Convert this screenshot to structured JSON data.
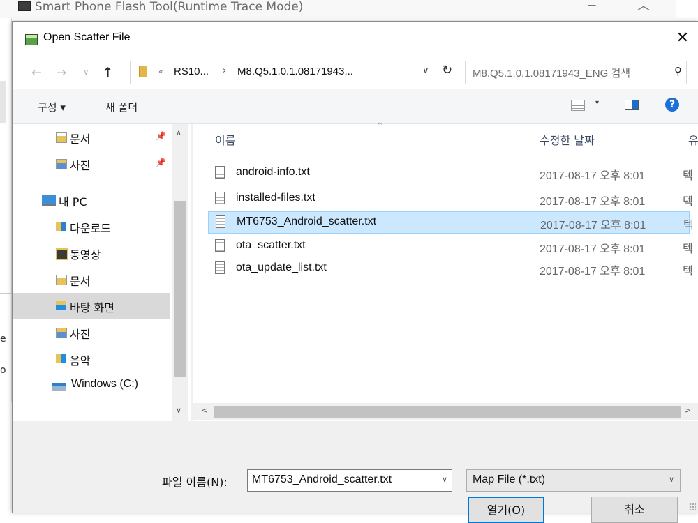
{
  "background_window": {
    "title": "Smart Phone Flash Tool(Runtime Trace Mode)",
    "minimize_glyph": "─",
    "maximize_glyph": "︿",
    "left_glyph_1": "e",
    "left_glyph_2": "o"
  },
  "dialog": {
    "title": "Open Scatter File",
    "close_glyph": "✕"
  },
  "address": {
    "back_glyph": "←",
    "forward_glyph": "→",
    "recent_glyph": "∨",
    "up_glyph": "↑",
    "overflow": "«",
    "crumb1": "RS10...",
    "separator": "›",
    "crumb2": "M8.Q5.1.0.1.08171943...",
    "dropdown_glyph": "∨",
    "refresh_glyph": "↻",
    "search_placeholder": "M8.Q5.1.0.1.08171943_ENG 검색",
    "search_glyph": "⚲"
  },
  "toolbar": {
    "organize": "구성 ▾",
    "new_folder": "새 폴더",
    "view_arrow": "▾",
    "help": "?"
  },
  "nav": {
    "items": [
      {
        "label": "문서",
        "pinned": true,
        "icon": "documents-icon"
      },
      {
        "label": "사진",
        "pinned": true,
        "icon": "pictures-icon"
      },
      {
        "label": "내 PC",
        "icon": "pc-icon"
      },
      {
        "label": "다운로드",
        "icon": "downloads-icon"
      },
      {
        "label": "동영상",
        "icon": "videos-icon"
      },
      {
        "label": "문서",
        "icon": "documents-icon"
      },
      {
        "label": "바탕 화면",
        "icon": "desktop-icon",
        "selected": true
      },
      {
        "label": "사진",
        "icon": "pictures-icon"
      },
      {
        "label": "음악",
        "icon": "music-icon"
      },
      {
        "label": "Windows (C:)",
        "icon": "drive-icon"
      }
    ],
    "pin_glyph": "📌",
    "scroll_up": "∧",
    "scroll_down": "∨"
  },
  "files": {
    "columns": {
      "name": "이름",
      "date": "수정한 날짜",
      "type": "유"
    },
    "sort_glyph": "^",
    "rows": [
      {
        "name": "android-info.txt",
        "date": "2017-08-17 오후 8:01",
        "type": "텍"
      },
      {
        "name": "installed-files.txt",
        "date": "2017-08-17 오후 8:01",
        "type": "텍"
      },
      {
        "name": "MT6753_Android_scatter.txt",
        "date": "2017-08-17 오후 8:01",
        "type": "텍",
        "selected": true
      },
      {
        "name": "ota_scatter.txt",
        "date": "2017-08-17 오후 8:01",
        "type": "텍"
      },
      {
        "name": "ota_update_list.txt",
        "date": "2017-08-17 오후 8:01",
        "type": "텍"
      }
    ],
    "hscroll_left": "<",
    "hscroll_right": ">"
  },
  "bottom": {
    "filename_label": "파일 이름(N):",
    "filename_value": "MT6753_Android_scatter.txt",
    "filter_value": "Map File (*.txt)",
    "dropdown_glyph": "∨",
    "open_button": "열기(O)",
    "cancel_button": "취소"
  }
}
